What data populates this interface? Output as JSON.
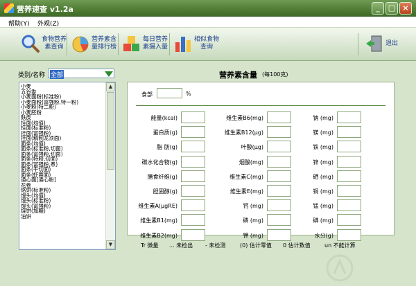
{
  "window": {
    "title": "营养速查 v1.2a"
  },
  "menu": [
    "帮助(Y)",
    "外观(Z)"
  ],
  "toolbar": [
    {
      "label": "食物营养\n素查询",
      "icon": "magnifier-icon"
    },
    {
      "label": "营养素含\n量排行榜",
      "icon": "pie-chart-icon"
    },
    {
      "label": "每日营养\n素摄入量",
      "icon": "cubes-icon"
    },
    {
      "label": "相似食物\n查询",
      "icon": "bar-chart-icon"
    },
    {
      "label": "退出",
      "icon": "exit-door-icon"
    }
  ],
  "category": {
    "label": "类别/名称",
    "value": "全部"
  },
  "food_list": [
    "小麦",
    "五谷香",
    "小麦面粉(标准粉)",
    "小麦面粉(富强粉,特一粉)",
    "小麦粉(特二粉)",
    "小麦胚粉",
    "麸皮",
    "挂面(均值)",
    "挂面(标准粉)",
    "挂面(富强粉)",
    "挂面(精制龙须面)",
    "面条(均值)",
    "面条(标准粉,切面)",
    "面条(富强粉,切面)",
    "面条(特粉,切面)",
    "面条(富强粉,煮)",
    "面条(干切面)",
    "面条(虾蓉面)",
    "通心面[通心粉]",
    "花卷",
    "烙饼(标准粉)",
    "馒头(均值)",
    "馒头(标准粉)",
    "馒头(富强粉)",
    "烧饼(加糖)",
    "油饼"
  ],
  "panel": {
    "title": "营养素含量",
    "subtitle": "(每100克)",
    "food_label": "食部",
    "food_unit": "%"
  },
  "nutrients_col1": [
    "能量(kcal)",
    "蛋白质(g)",
    "脂 肪(g)",
    "碳水化合物(g)",
    "膳食纤维(g)",
    "胆固醇(g)",
    "维生素A(μgRE)",
    "维生素B1(mg)",
    "维生素B2(mg)"
  ],
  "nutrients_col2": [
    "维生素B6(mg)",
    "维生素B12(μg)",
    "叶酸(μg)",
    "烟酸(mg)",
    "维生素C(mg)",
    "维生素E(mg)",
    "钙 (mg)",
    "磷 (mg)",
    "钾 (mg)"
  ],
  "nutrients_col3": [
    "钠 (mg)",
    "镁 (mg)",
    "铁 (mg)",
    "锌 (mg)",
    "硒 (mg)",
    "铜 (mg)",
    "锰 (mg)",
    "碘 (mg)",
    "水分(g)"
  ],
  "legend": [
    "Tr 微量",
    "... 未检出",
    "- 未检测",
    "(0) 估计零值",
    "0 估计数值",
    "un 不能计算"
  ]
}
